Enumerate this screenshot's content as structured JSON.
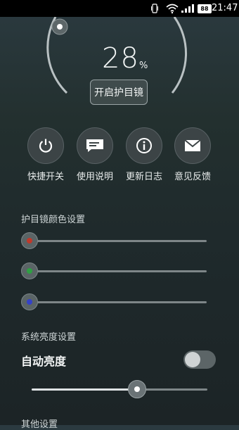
{
  "status_bar": {
    "time": "21:47",
    "battery": "88"
  },
  "gauge": {
    "value": "28",
    "unit": "%",
    "button_label": "开启护目镜"
  },
  "actions": [
    {
      "label": "快捷开关",
      "icon": "power-icon"
    },
    {
      "label": "使用说明",
      "icon": "message-icon"
    },
    {
      "label": "更新日志",
      "icon": "info-icon"
    },
    {
      "label": "意见反馈",
      "icon": "mail-icon"
    }
  ],
  "color_settings": {
    "title": "护目镜颜色设置",
    "sliders": [
      {
        "name": "red",
        "dot_color": "#c0392b",
        "level": 0
      },
      {
        "name": "green",
        "dot_color": "#2ea043",
        "level": 0
      },
      {
        "name": "blue",
        "dot_color": "#3442c8",
        "level": 0
      }
    ]
  },
  "brightness_settings": {
    "title": "系统亮度设置",
    "auto_label": "自动亮度",
    "auto_enabled": false,
    "level": 0.6
  },
  "other_settings": {
    "title": "其他设置"
  }
}
